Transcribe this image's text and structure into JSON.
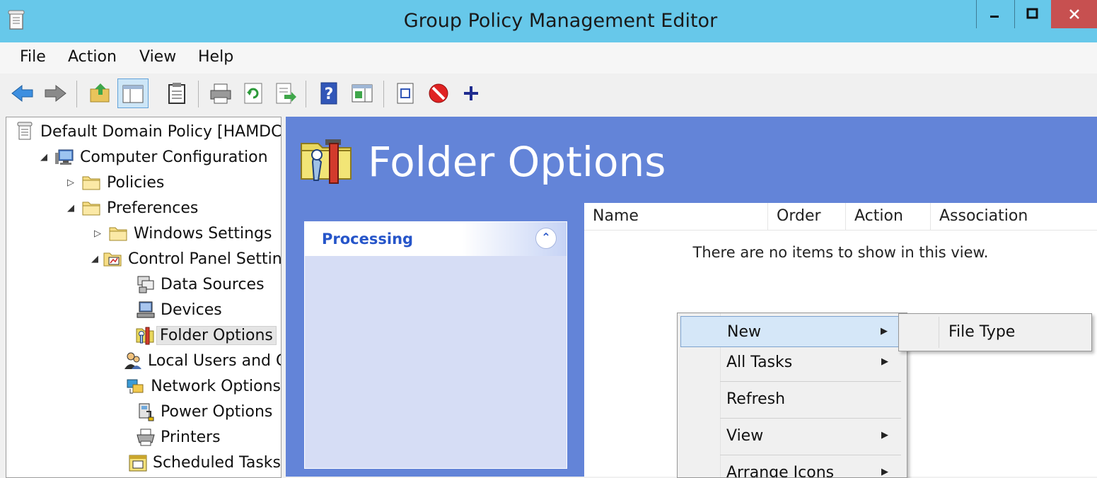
{
  "window": {
    "title": "Group Policy Management Editor"
  },
  "menubar": {
    "items": [
      "File",
      "Action",
      "View",
      "Help"
    ]
  },
  "toolbar": {
    "icons": [
      "back-arrow-icon",
      "forward-arrow-icon",
      "up-folder-icon",
      "show-hide-tree-icon",
      "clipboard-icon",
      "print-icon",
      "refresh-icon",
      "export-list-icon",
      "help-icon",
      "show-hide-action-pane-icon",
      "properties-icon",
      "stop-icon",
      "add-icon"
    ]
  },
  "tree": {
    "items": [
      {
        "label": "Default Domain Policy [HAMDC",
        "icon": "policy-document-icon"
      },
      {
        "label": "Computer Configuration",
        "icon": "computer-icon",
        "arrow": "expanded"
      },
      {
        "label": "Policies",
        "icon": "folder-icon",
        "arrow": "collapsed"
      },
      {
        "label": "Preferences",
        "icon": "folder-icon",
        "arrow": "expanded"
      },
      {
        "label": "Windows Settings",
        "icon": "folder-icon",
        "arrow": "collapsed"
      },
      {
        "label": "Control Panel Setting",
        "icon": "control-panel-folder-icon",
        "arrow": "expanded"
      },
      {
        "label": "Data Sources",
        "icon": "data-sources-icon"
      },
      {
        "label": "Devices",
        "icon": "devices-icon"
      },
      {
        "label": "Folder Options",
        "icon": "folder-options-icon",
        "selected": true
      },
      {
        "label": "Local Users and G",
        "icon": "local-users-icon"
      },
      {
        "label": "Network Options",
        "icon": "network-options-icon"
      },
      {
        "label": "Power Options",
        "icon": "power-options-icon"
      },
      {
        "label": "Printers",
        "icon": "printers-icon"
      },
      {
        "label": "Scheduled Tasks",
        "icon": "scheduled-tasks-icon"
      }
    ]
  },
  "main": {
    "title": "Folder Options",
    "processing": {
      "title": "Processing"
    },
    "list": {
      "columns": [
        "Name",
        "Order",
        "Action",
        "Association"
      ],
      "empty_message": "There are no items to show in this view."
    }
  },
  "context_menu": {
    "items": [
      {
        "label": "New",
        "submenu": true,
        "highlighted": true
      },
      {
        "label": "All Tasks",
        "submenu": true
      },
      {
        "label": "Refresh",
        "submenu": false
      },
      {
        "label": "View",
        "submenu": true
      },
      {
        "label": "Arrange Icons",
        "submenu": true
      }
    ],
    "submenu": {
      "items": [
        "File Type"
      ]
    }
  },
  "colors": {
    "titlebar": "#67c8ea",
    "header_background": "#6384d8",
    "processing_title": "#2655c9",
    "close_button": "#c75050",
    "menu_highlight": "#d5e7f8"
  }
}
